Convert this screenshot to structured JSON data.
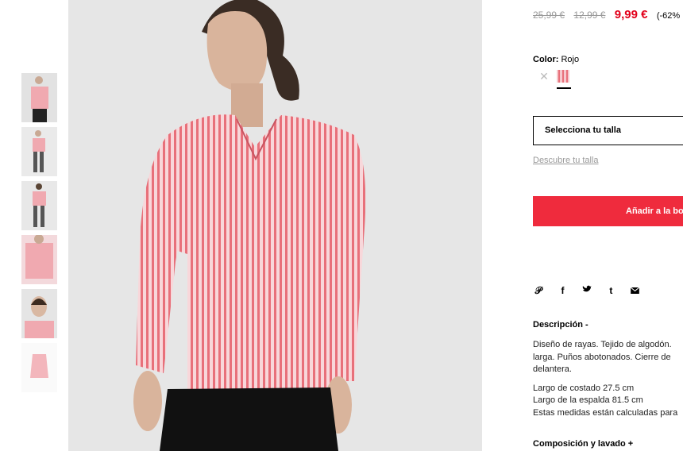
{
  "price": {
    "original": "25,99 €",
    "previous": "12,99 €",
    "current": "9,99 €",
    "discount": "(-62%"
  },
  "color": {
    "label": "Color:",
    "value": "Rojo"
  },
  "size": {
    "select_label": "Selecciona tu talla",
    "help_link": "Descubre tu talla"
  },
  "cart": {
    "add_label": "Añadir a la bo"
  },
  "share_icons": [
    "pinterest-icon",
    "facebook-icon",
    "twitter-icon",
    "tumblr-icon",
    "email-icon"
  ],
  "description": {
    "title": "Descripción -",
    "lines": [
      "Diseño de rayas. Tejido de algodón.",
      "larga. Puños abotonados. Cierre de",
      "delantera."
    ],
    "measures": [
      "Largo de costado 27.5 cm",
      "Largo de la espalda 81.5 cm",
      "Estas medidas están calculadas para"
    ]
  },
  "composition": {
    "title": "Composición y lavado +"
  },
  "colors": {
    "sale_red": "#e2001a",
    "button_red": "#ef2b3d",
    "stripe_pink": "#e8707a"
  }
}
